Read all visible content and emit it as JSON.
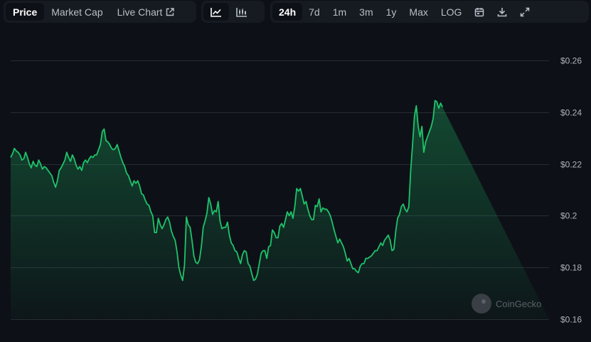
{
  "toolbar": {
    "metric_tabs": [
      {
        "label": "Price",
        "active": true
      },
      {
        "label": "Market Cap",
        "active": false
      },
      {
        "label": "Live Chart",
        "active": false,
        "icon": "external-link-icon"
      }
    ],
    "chart_type_buttons": [
      {
        "icon": "line-chart-icon",
        "active": true
      },
      {
        "icon": "candlestick-chart-icon",
        "active": false
      }
    ],
    "ranges": [
      {
        "label": "24h",
        "active": true
      },
      {
        "label": "7d",
        "active": false
      },
      {
        "label": "1m",
        "active": false
      },
      {
        "label": "3m",
        "active": false
      },
      {
        "label": "1y",
        "active": false
      },
      {
        "label": "Max",
        "active": false
      },
      {
        "label": "LOG",
        "active": false
      }
    ],
    "tool_icons": [
      "calendar-icon",
      "download-icon",
      "fullscreen-icon"
    ]
  },
  "watermark": "CoinGecko",
  "colors": {
    "background": "#0d1117",
    "line": "#1fc36b",
    "grid": "#262c33"
  },
  "chart_data": {
    "type": "area",
    "title": "",
    "xlabel": "",
    "ylabel": "",
    "ylim": [
      0.16,
      0.26
    ],
    "yticks": [
      0.16,
      0.18,
      0.2,
      0.22,
      0.24,
      0.26
    ],
    "ytick_labels": [
      "$0.16",
      "$0.18",
      "$0.2",
      "$0.22",
      "$0.24",
      "$0.26"
    ],
    "grid": true,
    "legend": "none",
    "x": [
      0,
      1,
      2,
      3,
      4,
      5,
      6,
      7,
      8,
      9,
      10,
      11,
      12,
      13,
      14,
      15,
      16,
      17,
      18,
      19,
      20,
      21,
      22,
      23,
      24,
      25,
      26,
      27,
      28,
      29,
      30,
      31,
      32,
      33,
      34,
      35,
      36,
      37,
      38,
      39,
      40,
      41,
      42,
      43,
      44,
      45,
      46,
      47,
      48,
      49,
      50,
      51,
      52,
      53,
      54,
      55,
      56,
      57,
      58,
      59,
      60,
      61,
      62,
      63,
      64,
      65,
      66,
      67,
      68,
      69,
      70,
      71,
      72,
      73,
      74,
      75,
      76,
      77,
      78,
      79,
      80,
      81,
      82,
      83,
      84,
      85,
      86,
      87,
      88,
      89,
      90,
      91,
      92,
      93,
      94,
      95,
      96,
      97,
      98,
      99,
      100,
      101,
      102,
      103,
      104,
      105,
      106,
      107,
      108,
      109,
      110,
      111,
      112,
      113,
      114,
      115,
      116,
      117,
      118,
      119,
      120,
      121,
      122,
      123,
      124,
      125,
      126,
      127,
      128,
      129,
      130,
      131,
      132,
      133,
      134,
      135,
      136,
      137,
      138,
      139,
      140,
      141,
      142,
      143,
      144,
      145,
      146,
      147,
      148,
      149,
      150,
      151,
      152,
      153,
      154,
      155,
      156,
      157,
      158,
      159,
      160,
      161,
      162,
      163,
      164,
      165,
      166,
      167,
      168,
      169,
      170,
      171,
      172,
      173,
      174,
      175,
      176,
      177,
      178,
      179,
      180,
      181,
      182,
      183,
      184,
      185,
      186,
      187,
      188,
      189,
      190,
      191,
      192,
      193,
      194,
      195,
      196,
      197,
      198,
      199,
      200,
      201,
      202,
      203,
      204,
      205,
      206,
      207,
      208,
      209,
      210,
      211,
      212,
      213,
      214,
      215,
      216,
      217,
      218,
      219,
      220,
      221,
      222,
      223,
      224,
      225,
      226,
      227,
      228,
      229,
      230,
      231,
      232,
      233,
      234,
      235,
      236,
      237,
      238,
      239,
      240,
      241,
      242,
      243,
      244,
      245,
      246,
      247,
      248,
      249,
      250,
      251,
      252,
      253,
      254,
      255,
      256,
      257,
      258,
      259,
      260,
      261,
      262,
      263,
      264,
      265,
      266,
      267,
      268,
      269,
      270,
      271,
      272,
      273,
      274,
      275,
      276,
      277,
      278,
      279,
      280,
      281,
      282,
      283,
      284,
      285,
      286,
      287,
      288
    ],
    "series": [
      {
        "values": [
          0.2225,
          0.224,
          0.226,
          0.225,
          0.2245,
          0.2235,
          0.2215,
          0.222,
          0.2245,
          0.2225,
          0.22,
          0.2185,
          0.221,
          0.2195,
          0.219,
          0.2215,
          0.22,
          0.218,
          0.219,
          0.2185,
          0.2175,
          0.2165,
          0.2155,
          0.213,
          0.211,
          0.2135,
          0.2175,
          0.2185,
          0.22,
          0.2215,
          0.2245,
          0.2225,
          0.221,
          0.2235,
          0.222,
          0.2195,
          0.218,
          0.219,
          0.2175,
          0.2205,
          0.2215,
          0.2205,
          0.222,
          0.223,
          0.2225,
          0.2235,
          0.2235,
          0.2255,
          0.2275,
          0.2325,
          0.2335,
          0.229,
          0.2285,
          0.2275,
          0.226,
          0.2255,
          0.226,
          0.2275,
          0.225,
          0.2225,
          0.2205,
          0.219,
          0.2165,
          0.2155,
          0.2135,
          0.2115,
          0.2135,
          0.2125,
          0.2135,
          0.2115,
          0.2085,
          0.208,
          0.206,
          0.2045,
          0.204,
          0.2015,
          0.2,
          0.1935,
          0.1935,
          0.199,
          0.1965,
          0.195,
          0.1965,
          0.1985,
          0.1995,
          0.1975,
          0.194,
          0.192,
          0.1905,
          0.186,
          0.18,
          0.177,
          0.175,
          0.181,
          0.1995,
          0.1965,
          0.1955,
          0.1905,
          0.1845,
          0.182,
          0.1815,
          0.183,
          0.188,
          0.1955,
          0.198,
          0.201,
          0.207,
          0.2045,
          0.2005,
          0.202,
          0.2015,
          0.2055,
          0.198,
          0.195,
          0.1955,
          0.1955,
          0.1975,
          0.1925,
          0.1895,
          0.1885,
          0.1865,
          0.186,
          0.1835,
          0.1815,
          0.185,
          0.1865,
          0.186,
          0.1815,
          0.1805,
          0.1775,
          0.175,
          0.1755,
          0.1775,
          0.1815,
          0.1855,
          0.1865,
          0.1865,
          0.1835,
          0.188,
          0.1885,
          0.1945,
          0.1935,
          0.1915,
          0.1915,
          0.196,
          0.197,
          0.1955,
          0.1985,
          0.2015,
          0.2,
          0.2015,
          0.199,
          0.2035,
          0.2105,
          0.2095,
          0.2105,
          0.2075,
          0.2045,
          0.2055,
          0.2025,
          0.2,
          0.1985,
          0.1985,
          0.204,
          0.2035,
          0.2065,
          0.2015,
          0.203,
          0.2025,
          0.2025,
          0.2015,
          0.2,
          0.1975,
          0.1945,
          0.192,
          0.1895,
          0.191,
          0.1895,
          0.188,
          0.1855,
          0.1825,
          0.1835,
          0.1815,
          0.1795,
          0.1795,
          0.1785,
          0.178,
          0.1805,
          0.1815,
          0.1815,
          0.1835,
          0.1835,
          0.184,
          0.1845,
          0.1855,
          0.1865,
          0.1865,
          0.188,
          0.1895,
          0.1885,
          0.1905,
          0.1915,
          0.1925,
          0.1905,
          0.1865,
          0.187,
          0.194,
          0.199,
          0.2005,
          0.2035,
          0.2045,
          0.2025,
          0.2015,
          0.2035,
          0.2175,
          0.2275,
          0.2385,
          0.2425,
          0.2345,
          0.2305,
          0.2345,
          0.2245,
          0.2285,
          0.2305,
          0.2325,
          0.2345,
          0.2375,
          0.2445,
          0.244,
          0.2415,
          0.2435,
          0.242
        ],
        "color": "#1fc36b"
      }
    ]
  }
}
